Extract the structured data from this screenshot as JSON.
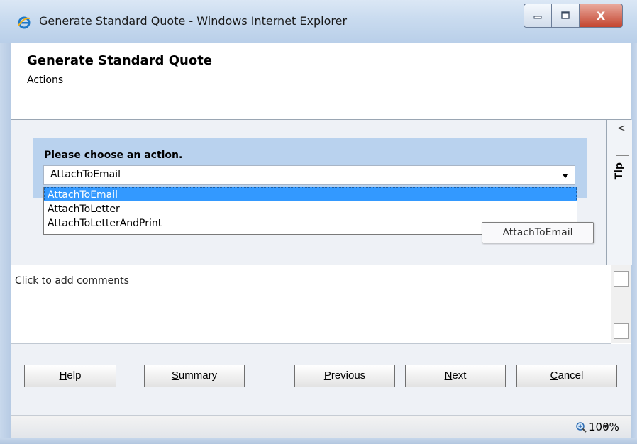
{
  "window": {
    "title": "Generate Standard Quote - Windows Internet Explorer",
    "icon": "ie-icon",
    "controls": {
      "minimize_icon": "minimize-icon",
      "maximize_icon": "maximize-icon",
      "close_glyph": "X"
    }
  },
  "header": {
    "title": "Generate Standard Quote",
    "subtitle": "Actions"
  },
  "action": {
    "label": "Please choose an action.",
    "selected_value": "AttachToEmail",
    "options": [
      "AttachToEmail",
      "AttachToLetter",
      "AttachToLetterAndPrint"
    ],
    "highlighted_option": "AttachToEmail",
    "tooltip": "AttachToEmail"
  },
  "tip_panel": {
    "collapse_glyph": "<",
    "label": "Tip"
  },
  "comments": {
    "placeholder": "Click to add comments"
  },
  "buttons": {
    "help": {
      "pre": "",
      "mnemonic": "H",
      "post": "elp"
    },
    "summary": {
      "pre": "",
      "mnemonic": "S",
      "post": "ummary"
    },
    "previous": {
      "pre": "",
      "mnemonic": "P",
      "post": "revious"
    },
    "next": {
      "pre": "",
      "mnemonic": "N",
      "post": "ext"
    },
    "cancel": {
      "pre": "",
      "mnemonic": "C",
      "post": "ancel"
    }
  },
  "statusbar": {
    "zoom": "100%",
    "zoom_icon": "zoom-icon"
  },
  "colors": {
    "accent_panel": "#b9d2ee",
    "selection": "#3399ff",
    "close_button": "#c4452f"
  }
}
